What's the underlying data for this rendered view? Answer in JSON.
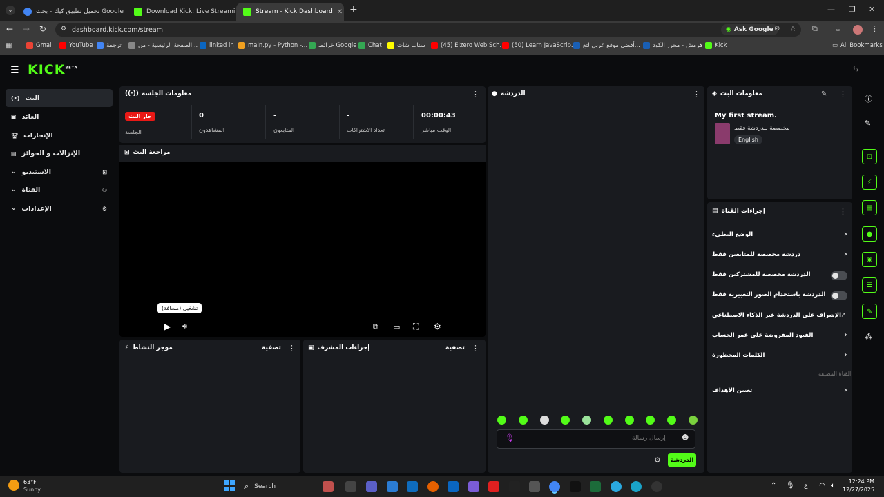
{
  "browser": {
    "tabs": [
      {
        "label": "تحميل تطبيق كيك - بحث Google",
        "color": "#4285f4"
      },
      {
        "label": "Download Kick: Live Streaming",
        "color": "#53fc18"
      },
      {
        "label": "Stream - Kick Dashboard",
        "color": "#53fc18"
      }
    ],
    "new_tab": "+",
    "url": "dashboard.kick.com/stream",
    "ask_google": "Ask Google",
    "bookmarks": [
      "Gmail",
      "YouTube",
      "ترجمة",
      "الصفحة الرئيسية - من...",
      "linked in",
      "main.py - Python -...",
      "خرائط Google",
      "Chat",
      "سناب شات",
      "(45) Elzero Web Sch...",
      "(50) Learn JavaScrip...",
      "أفضل موقع عربي لتع...",
      "هرمش - محرر الكود",
      "Kick"
    ],
    "all_bookmarks": "All Bookmarks"
  },
  "app": {
    "logo": "KICK",
    "logo_badge": "BETA"
  },
  "sidebar": {
    "items": [
      {
        "label": "البث",
        "icon": "broadcast-icon",
        "active": true
      },
      {
        "label": "العائد",
        "icon": "revenue-icon"
      },
      {
        "label": "الإنجازات",
        "icon": "trophy-icon"
      },
      {
        "label": "الإنزالات و الجوائز",
        "icon": "drops-icon"
      },
      {
        "label": "الاستيديو",
        "icon": "studio-icon",
        "expandable": true
      },
      {
        "label": "القناة",
        "icon": "channel-icon",
        "expandable": true
      },
      {
        "label": "الإعدادات",
        "icon": "gear-icon",
        "expandable": true
      }
    ]
  },
  "session": {
    "title": "معلومات الجلسة",
    "live_badge": "جار البث",
    "stats": [
      {
        "value": "00:00:43",
        "label": "الوقت مباشر"
      },
      {
        "value": "-",
        "label": "تعداد الاشتراكات"
      },
      {
        "value": "-",
        "label": "المتابعون"
      },
      {
        "value": "0",
        "label": "المشاهدون"
      },
      {
        "value": "",
        "label": "الجلسة"
      }
    ]
  },
  "preview": {
    "title": "مراجعة البث",
    "tooltip": "تشغيل (مسافة)"
  },
  "activity": {
    "title": "موجز النشاط",
    "filter": "تصفية"
  },
  "modactions": {
    "title": "إجراءات المشرف",
    "filter": "تصفية"
  },
  "chat": {
    "title": "الدردشة",
    "placeholder": "إرسال رسالة",
    "send": "الدردشة"
  },
  "stream_info": {
    "title": "معلومات البث",
    "stream_title": "My first stream.",
    "category": "مخصصة للدردشة فقط",
    "language": "English"
  },
  "channel_actions": {
    "title": "إجراءات القناة",
    "items": [
      {
        "label": "الوضع البطيء",
        "type": "chevron"
      },
      {
        "label": "دردشة مخصصة للمتابعين فقط",
        "type": "chevron"
      },
      {
        "label": "الدردشة مخصصة للمشتركين فقط",
        "type": "toggle"
      },
      {
        "label": "الدردشة باستخدام الصور التعبيرية فقط",
        "type": "toggle"
      },
      {
        "label": "الإشراف على الدردشة عبر الذكاء الاصطناعي",
        "type": "external"
      },
      {
        "label": "القيود المفروضة على عمر الحساب",
        "type": "chevron"
      },
      {
        "label": "الكلمات المحظورة",
        "type": "chevron"
      }
    ],
    "section_label": "القناة المضيفة",
    "host_item": "تعيين الأهداف"
  },
  "taskbar": {
    "weather_temp": "63°F",
    "weather_desc": "Sunny",
    "search": "Search",
    "lang": "ع",
    "time": "12:24 PM",
    "date": "12/27/2025"
  },
  "colors": {
    "accent": "#53fc18",
    "live": "#e91916",
    "panel": "#191b1f",
    "bg": "#0b0c0e"
  }
}
